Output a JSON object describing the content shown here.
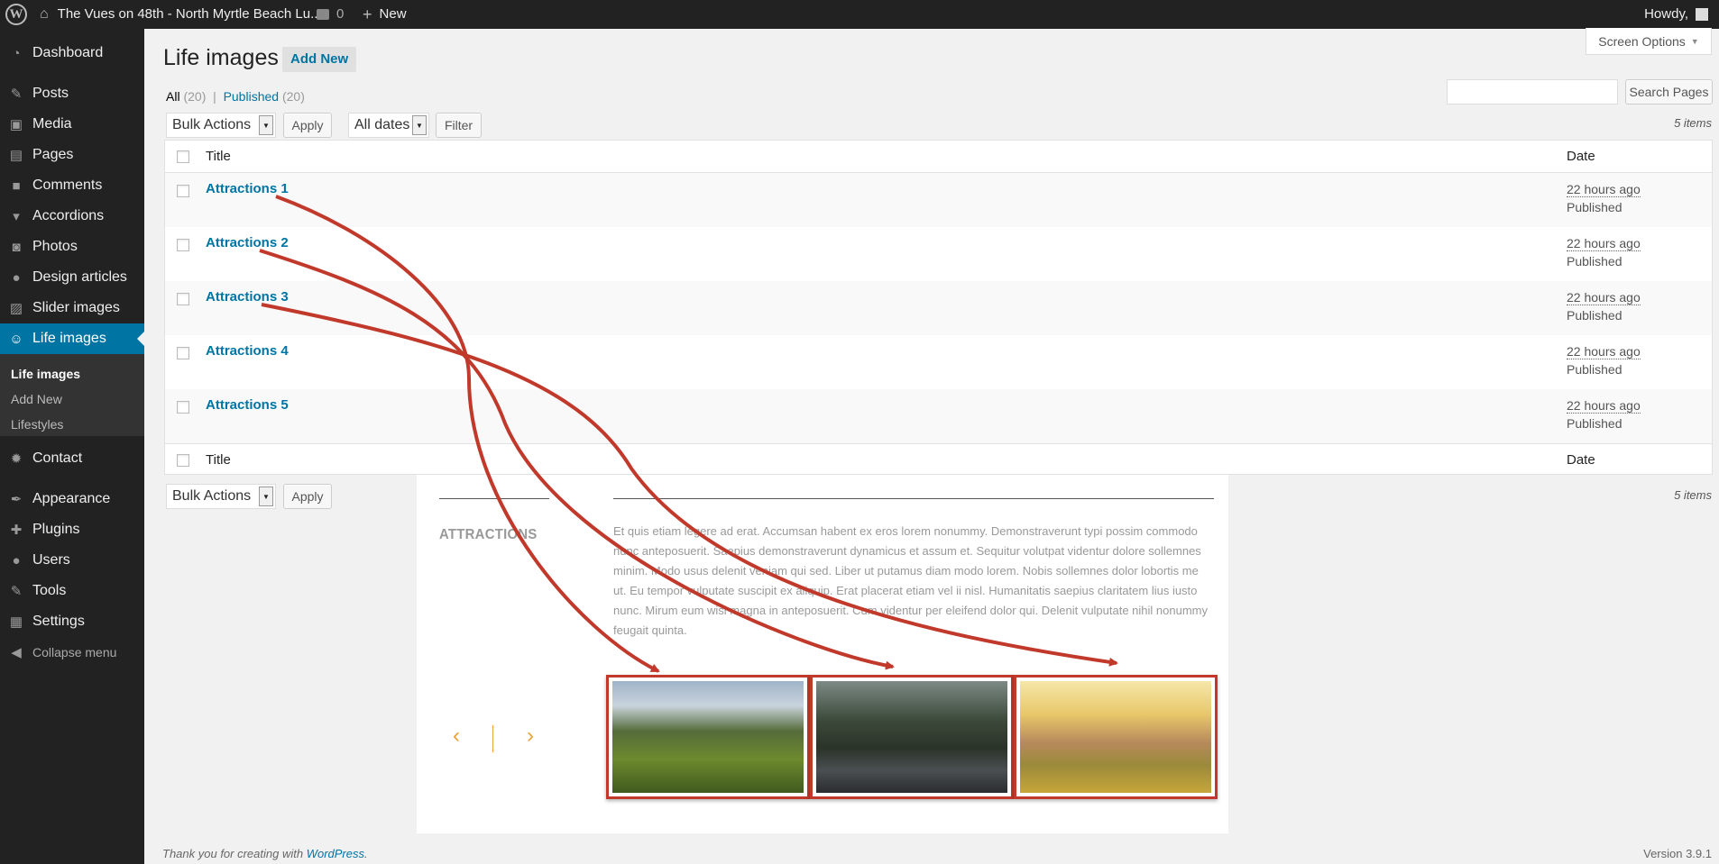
{
  "admin_bar": {
    "wp_logo_glyph": "W",
    "site_name": "The Vues on 48th - North Myrtle Beach Lu...",
    "comments_count": "0",
    "new_label": "New",
    "howdy": "Howdy,"
  },
  "sidebar": {
    "items": [
      {
        "label": "Dashboard",
        "icon": "dashboard-icon",
        "glyph": "◔"
      },
      {
        "label": "Posts",
        "icon": "pin-icon",
        "glyph": "✎"
      },
      {
        "label": "Media",
        "icon": "media-icon",
        "glyph": "▣"
      },
      {
        "label": "Pages",
        "icon": "pages-icon",
        "glyph": "▤"
      },
      {
        "label": "Comments",
        "icon": "comments-icon",
        "glyph": "■"
      },
      {
        "label": "Accordions",
        "icon": "accordions-icon",
        "glyph": "▾"
      },
      {
        "label": "Photos",
        "icon": "photos-icon",
        "glyph": "◙"
      },
      {
        "label": "Design articles",
        "icon": "design-icon",
        "glyph": "●"
      },
      {
        "label": "Slider images",
        "icon": "slider-icon",
        "glyph": "▨"
      },
      {
        "label": "Life images",
        "icon": "smiley-icon",
        "glyph": "☺"
      },
      {
        "label": "Contact",
        "icon": "gear-icon",
        "glyph": "✹"
      },
      {
        "label": "Appearance",
        "icon": "brush-icon",
        "glyph": "✒"
      },
      {
        "label": "Plugins",
        "icon": "plugins-icon",
        "glyph": "✚"
      },
      {
        "label": "Users",
        "icon": "user-icon",
        "glyph": "●"
      },
      {
        "label": "Tools",
        "icon": "wrench-icon",
        "glyph": "✎"
      },
      {
        "label": "Settings",
        "icon": "settings-icon",
        "glyph": "▦"
      },
      {
        "label": "Collapse menu",
        "icon": "collapse-icon",
        "glyph": "◀"
      }
    ],
    "submenu": [
      "Life images",
      "Add New",
      "Lifestyles"
    ]
  },
  "header": {
    "title": "Life images",
    "add_new": "Add New",
    "screen_options": "Screen Options",
    "screen_options_arrow": "▼"
  },
  "views": {
    "all_label": "All",
    "all_count": "(20)",
    "separator": "|",
    "published_label": "Published",
    "published_count": "(20)"
  },
  "search": {
    "button": "Search Pages",
    "value": ""
  },
  "filters": {
    "bulk_actions": "Bulk Actions",
    "apply": "Apply",
    "all_dates": "All dates",
    "filter": "Filter",
    "items_count": "5 items",
    "dropdown_glyph": "▼"
  },
  "table": {
    "col_title": "Title",
    "col_date": "Date",
    "rows": [
      {
        "title": "Attractions 1",
        "date": "22 hours ago",
        "status": "Published"
      },
      {
        "title": "Attractions 2",
        "date": "22 hours ago",
        "status": "Published"
      },
      {
        "title": "Attractions 3",
        "date": "22 hours ago",
        "status": "Published"
      },
      {
        "title": "Attractions 4",
        "date": "22 hours ago",
        "status": "Published"
      },
      {
        "title": "Attractions 5",
        "date": "22 hours ago",
        "status": "Published"
      }
    ]
  },
  "preview": {
    "heading": "ATTRACTIONS",
    "paragraph": "Et quis etiam legere ad erat. Accumsan habent ex eros lorem nonummy. Demonstraverunt typi possim commodo nunc anteposuerit. Saepius demonstraverunt dynamicus et assum et. Sequitur volutpat videntur dolore sollemnes minim. Modo usus delenit veniam qui sed. Liber ut putamus diam modo lorem. Nobis sollemnes dolor lobortis me ut. Eu tempor vulputate suscipit ex aliquip. Erat placerat etiam vel ii nisl. Humanitatis saepius claritatem lius iusto nunc. Mirum eum wisi magna in anteposuerit. Cum videntur per eleifend dolor qui. Delenit vulputate nihil nonummy feugait quinta.",
    "prev_glyph": "‹",
    "next_glyph": "›",
    "thumbs": [
      "mountain-valley-image",
      "rainy-road-image",
      "sunny-building-image"
    ]
  },
  "footer": {
    "thanks": "Thank you for creating with",
    "wp_link": "WordPress",
    "period": ".",
    "version": "Version 3.9.1"
  },
  "colors": {
    "accent": "#0074a2",
    "annotation": "#c0392b",
    "carousel": "#e8a33a"
  }
}
